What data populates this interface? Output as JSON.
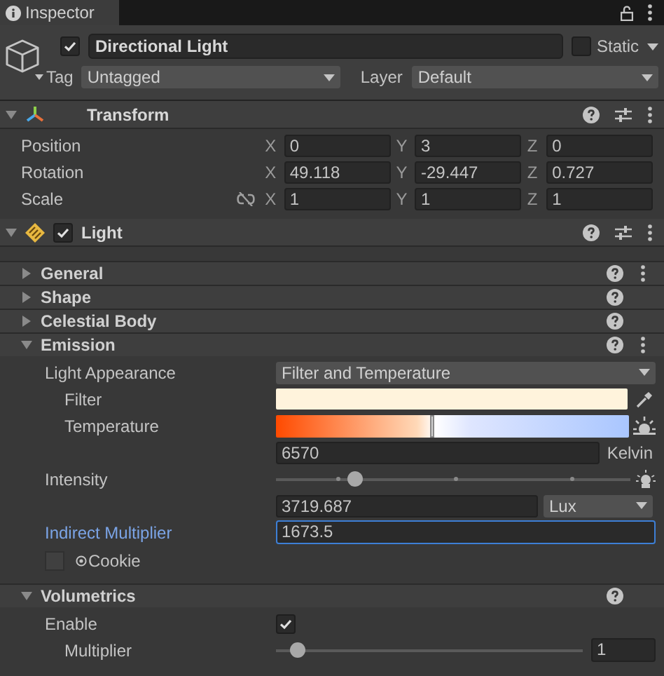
{
  "tab": {
    "label": "Inspector",
    "selected": true
  },
  "object": {
    "enabled": true,
    "name": "Directional Light",
    "static": false,
    "static_label": "Static",
    "tag_label": "Tag",
    "tag": "Untagged",
    "layer_label": "Layer",
    "layer": "Default"
  },
  "transform": {
    "title": "Transform",
    "expanded": true,
    "rows": [
      {
        "label": "Position",
        "link_icon": false,
        "fields": [
          {
            "axis": "X",
            "value": "0"
          },
          {
            "axis": "Y",
            "value": "3"
          },
          {
            "axis": "Z",
            "value": "0"
          }
        ]
      },
      {
        "label": "Rotation",
        "link_icon": false,
        "fields": [
          {
            "axis": "X",
            "value": "49.118"
          },
          {
            "axis": "Y",
            "value": "-29.447"
          },
          {
            "axis": "Z",
            "value": "0.727"
          }
        ]
      },
      {
        "label": "Scale",
        "link_icon": true,
        "fields": [
          {
            "axis": "X",
            "value": "1"
          },
          {
            "axis": "Y",
            "value": "1"
          },
          {
            "axis": "Z",
            "value": "1"
          }
        ]
      }
    ]
  },
  "light": {
    "title": "Light",
    "enabled": true,
    "expanded": true,
    "sections": [
      {
        "title": "General",
        "expanded": false,
        "menu": true
      },
      {
        "title": "Shape",
        "expanded": false,
        "menu": false
      },
      {
        "title": "Celestial Body",
        "expanded": false,
        "menu": false
      },
      {
        "title": "Emission",
        "expanded": true,
        "menu": true,
        "rows": [
          {
            "kind": "dropdown",
            "label": "Light Appearance",
            "value": "Filter and Temperature",
            "children": [
              {
                "kind": "color",
                "label": "Filter",
                "color": "#fff3dc"
              },
              {
                "kind": "temperature",
                "label": "Temperature",
                "level": 0.44,
                "value": "6570",
                "unit": "Kelvin"
              }
            ]
          },
          {
            "kind": "intensity",
            "label": "Intensity",
            "level": 0.22,
            "value": "3719.687",
            "unit": "Lux"
          },
          {
            "kind": "field",
            "label": "Indirect Multiplier",
            "value": "1673.5",
            "focused": true
          },
          {
            "kind": "object",
            "label": "Cookie"
          }
        ]
      },
      {
        "title": "Volumetrics",
        "expanded": true,
        "menu": false,
        "rows": [
          {
            "kind": "checkbox",
            "label": "Enable",
            "checked": true,
            "children": [
              {
                "kind": "slider",
                "label": "Multiplier",
                "level": 0.07,
                "value": "1"
              }
            ]
          }
        ]
      }
    ]
  }
}
